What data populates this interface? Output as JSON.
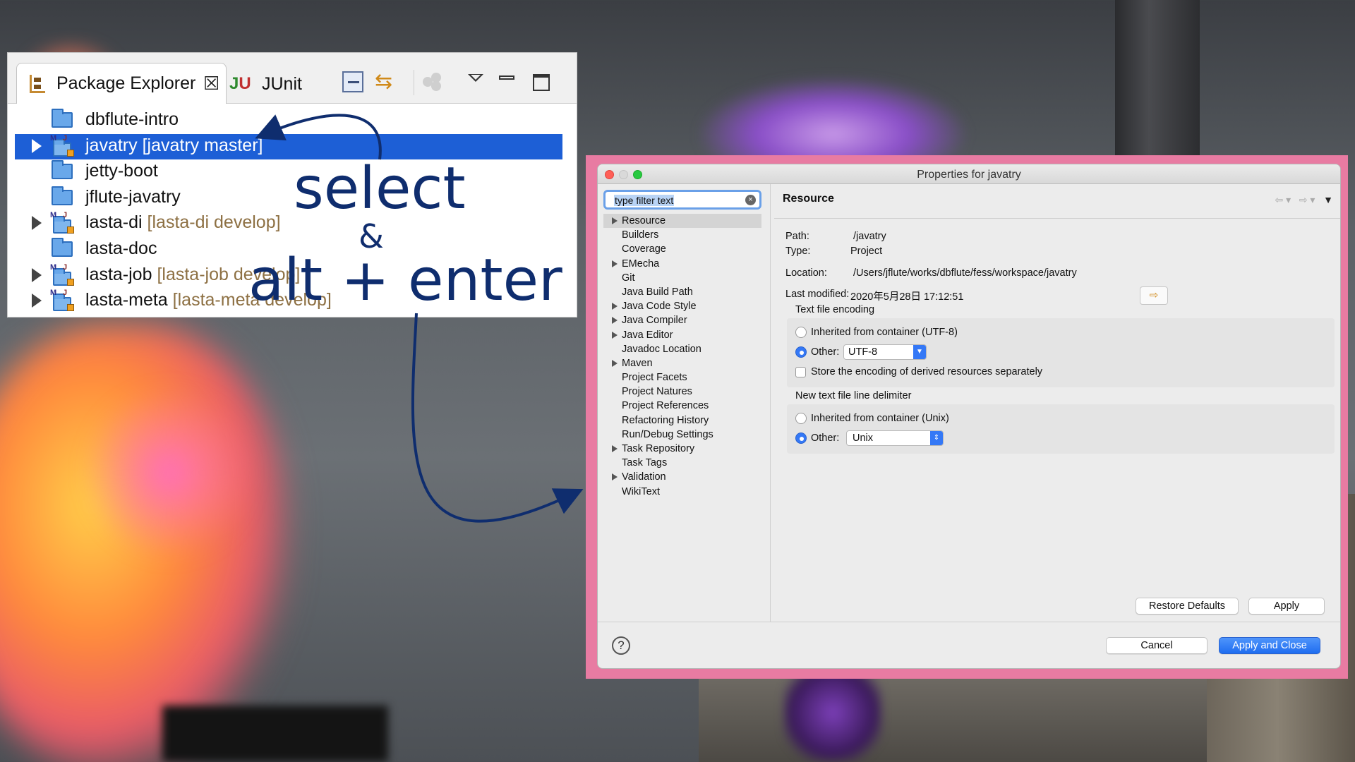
{
  "package_explorer": {
    "tab_label": "Package Explorer",
    "tab_close": "☒",
    "junit_label": "JUnit",
    "junit_icon_j": "J",
    "junit_icon_u": "U",
    "items": [
      {
        "name": "dbflute-intro",
        "branch": "",
        "type": "folder",
        "expandable": false,
        "selected": false
      },
      {
        "name": "javatry",
        "branch": "[javatry master]",
        "type": "project",
        "expandable": true,
        "selected": true
      },
      {
        "name": "jetty-boot",
        "branch": "",
        "type": "folder",
        "expandable": false,
        "selected": false
      },
      {
        "name": "jflute-javatry",
        "branch": "",
        "type": "folder",
        "expandable": false,
        "selected": false
      },
      {
        "name": "lasta-di",
        "branch": "[lasta-di develop]",
        "type": "project",
        "expandable": true,
        "selected": false
      },
      {
        "name": "lasta-doc",
        "branch": "",
        "type": "folder",
        "expandable": false,
        "selected": false
      },
      {
        "name": "lasta-job",
        "branch": "[lasta-job develop]",
        "type": "project",
        "expandable": true,
        "selected": false
      },
      {
        "name": "lasta-meta",
        "branch": "[lasta-meta develop]",
        "type": "project",
        "expandable": true,
        "selected": false
      }
    ]
  },
  "overlay": {
    "line1": "select",
    "line2": "&",
    "line3": "alt + enter",
    "color": "#0f2d6e"
  },
  "dialog": {
    "title": "Properties for javatry",
    "filter_placeholder": "type filter text",
    "nav": [
      {
        "label": "Resource",
        "expandable": true,
        "selected": true
      },
      {
        "label": "Builders",
        "expandable": false,
        "selected": false
      },
      {
        "label": "Coverage",
        "expandable": false,
        "selected": false
      },
      {
        "label": "EMecha",
        "expandable": true,
        "selected": false
      },
      {
        "label": "Git",
        "expandable": false,
        "selected": false
      },
      {
        "label": "Java Build Path",
        "expandable": false,
        "selected": false
      },
      {
        "label": "Java Code Style",
        "expandable": true,
        "selected": false
      },
      {
        "label": "Java Compiler",
        "expandable": true,
        "selected": false
      },
      {
        "label": "Java Editor",
        "expandable": true,
        "selected": false
      },
      {
        "label": "Javadoc Location",
        "expandable": false,
        "selected": false
      },
      {
        "label": "Maven",
        "expandable": true,
        "selected": false
      },
      {
        "label": "Project Facets",
        "expandable": false,
        "selected": false
      },
      {
        "label": "Project Natures",
        "expandable": false,
        "selected": false
      },
      {
        "label": "Project References",
        "expandable": false,
        "selected": false
      },
      {
        "label": "Refactoring History",
        "expandable": false,
        "selected": false
      },
      {
        "label": "Run/Debug Settings",
        "expandable": false,
        "selected": false
      },
      {
        "label": "Task Repository",
        "expandable": true,
        "selected": false
      },
      {
        "label": "Task Tags",
        "expandable": false,
        "selected": false
      },
      {
        "label": "Validation",
        "expandable": true,
        "selected": false
      },
      {
        "label": "WikiText",
        "expandable": false,
        "selected": false
      }
    ],
    "page_title": "Resource",
    "path_label": "Path:",
    "path_value": "/javatry",
    "type_label": "Type:",
    "type_value": "Project",
    "location_label": "Location:",
    "location_value": "/Users/jflute/works/dbflute/fess/workspace/javatry",
    "modified_label": "Last modified:",
    "modified_value": "2020年5月28日 17:12:51",
    "encoding": {
      "group_label": "Text file encoding",
      "inherited_label": "Inherited from container (UTF-8)",
      "other_label": "Other:",
      "other_value": "UTF-8",
      "other_selected": true,
      "store_label": "Store the encoding of derived resources separately",
      "store_checked": false
    },
    "delimiter": {
      "group_label": "New text file line delimiter",
      "inherited_label": "Inherited from container (Unix)",
      "other_label": "Other:",
      "other_value": "Unix",
      "other_selected": true
    },
    "buttons": {
      "restore_defaults": "Restore Defaults",
      "apply": "Apply",
      "cancel": "Cancel",
      "apply_and_close": "Apply and Close",
      "help": "?"
    }
  }
}
